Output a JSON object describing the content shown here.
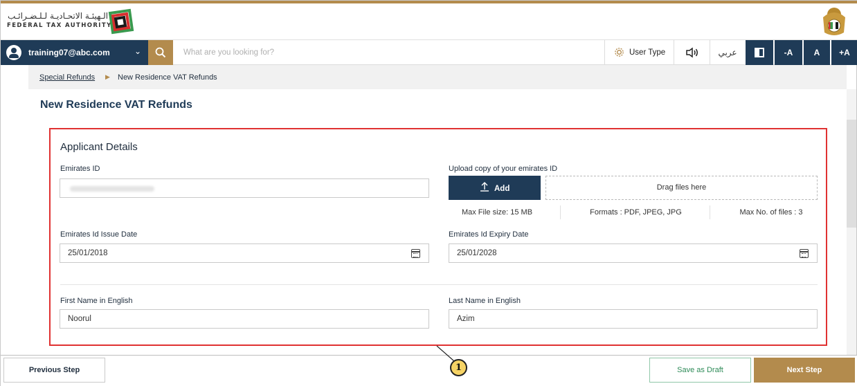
{
  "header": {
    "logo_arabic": "الـهيئـة الاتحـاديـة لـلـضـرائـب",
    "logo_english": "FEDERAL TAX AUTHORITY",
    "logo_icon": "fta-logo-icon",
    "emblem_icon": "uae-emblem-icon",
    "brand_color": "#b38b4d",
    "navy_color": "#1f3b57"
  },
  "navbar": {
    "user_email": "training07@abc.com",
    "search_placeholder": "What are you looking for?",
    "user_type_label": "User Type",
    "language_label": "عربي",
    "font_decrease": "-A",
    "font_normal": "A",
    "font_increase": "+A"
  },
  "breadcrumb": {
    "parent": "Special Refunds",
    "current": "New Residence VAT Refunds"
  },
  "page": {
    "title": "New Residence VAT Refunds"
  },
  "form": {
    "section_title": "Applicant Details",
    "emirates_id": {
      "label": "Emirates ID",
      "value": ""
    },
    "upload": {
      "label": "Upload copy of your emirates ID",
      "add_label": "Add",
      "dropzone_label": "Drag files here",
      "max_size": "Max File size: 15 MB",
      "formats": "Formats : PDF, JPEG, JPG",
      "max_files": "Max No. of files : 3"
    },
    "issue_date": {
      "label": "Emirates Id Issue Date",
      "value": "25/01/2018"
    },
    "expiry_date": {
      "label": "Emirates Id Expiry Date",
      "value": "25/01/2028"
    },
    "first_name": {
      "label": "First Name in English",
      "value": "Noorul"
    },
    "last_name": {
      "label": "Last Name in English",
      "value": "Azim"
    }
  },
  "footer": {
    "previous_label": "Previous Step",
    "draft_label": "Save as Draft",
    "next_label": "Next Step"
  },
  "annotation": {
    "callout_number": "1",
    "highlight_color": "#e03131"
  }
}
